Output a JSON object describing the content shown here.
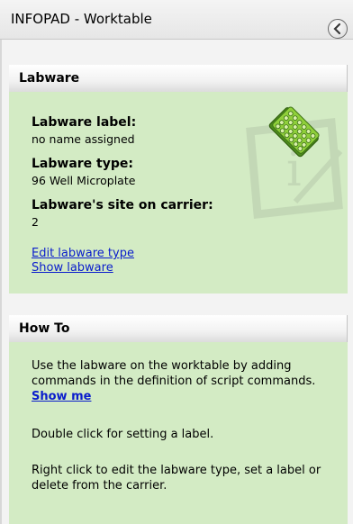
{
  "window": {
    "title": "INFOPAD - Worktable",
    "collapse_icon": "chevron-left-circle-icon"
  },
  "labware_panel": {
    "header": "Labware",
    "label_heading": "Labware label:",
    "label_value": "no name assigned",
    "type_heading": "Labware type:",
    "type_value": "96 Well Microplate",
    "site_heading": "Labware's site on carrier:",
    "site_value": "2",
    "edit_link": "Edit labware type",
    "show_link": "Show labware",
    "icon": "microplate-icon",
    "watermark_icon": "info-watermark-icon"
  },
  "howto_panel": {
    "header": "How To",
    "para1": "Use the labware on the worktable by adding commands in the definition of script commands.",
    "show_me": "Show me",
    "para2": "Double click for setting a label.",
    "para3": "Right click to edit the labware type, set a label or delete from the carrier."
  },
  "colors": {
    "panel_bg": "#d3ebc4",
    "link": "#0a1dcc",
    "plate_green": "#7fbf2a"
  }
}
